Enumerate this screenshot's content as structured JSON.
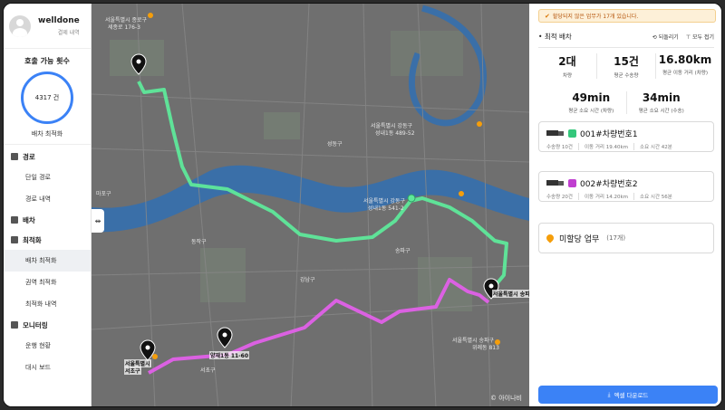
{
  "profile": {
    "name": "welldone",
    "sub_link": "결제 내역"
  },
  "quota": {
    "title": "호출 가능 횟수",
    "value": "4317 건",
    "button": "배차 최적화"
  },
  "menu": {
    "groups": [
      {
        "label": "경로",
        "items": [
          "단일 경로",
          "경로 내역"
        ]
      },
      {
        "label": "배차",
        "items": []
      },
      {
        "label": "최적화",
        "items": [
          "배차 최적화",
          "권역 최적화",
          "최적화 내역"
        ]
      },
      {
        "label": "모니터링",
        "items": [
          "운행 현황",
          "대시 보드"
        ]
      }
    ]
  },
  "map": {
    "labels": [
      "서울특별시 종로구",
      "세종로 176-3",
      "서울특별시 강동구",
      "성내1동 489-52",
      "서울특별시 강동구",
      "성내1동 541-2",
      "서울특별시 송파구",
      "위례동 813",
      "서울특별시",
      "서초구",
      "양재1동 11-60",
      "서울특별시 송파구",
      "송파구",
      "강남구",
      "서초구",
      "성동구",
      "동작구",
      "마포구"
    ],
    "watermark": "© 아이나비",
    "route_colors": {
      "vehicle1": "#5ee89a",
      "vehicle2": "#e060e8"
    }
  },
  "panel": {
    "alert": "할당되지 않은 업무가 17개 있습니다.",
    "section_title": "최적 배차",
    "actions": {
      "back": "되돌리기",
      "expand": "모두 접기"
    },
    "stats_row1": [
      {
        "value": "2대",
        "label": "차량"
      },
      {
        "value": "15건",
        "label": "평균 수송량"
      },
      {
        "value": "16.80km",
        "label": "평균 이동 거리 (차량)"
      }
    ],
    "stats_row2": [
      {
        "value": "49min",
        "label": "평균 소요 시간 (차량)"
      },
      {
        "value": "34min",
        "label": "평균 소요 시간 (수송)"
      }
    ],
    "vehicles": [
      {
        "name": "001#차량번호1",
        "color": "#34c77b",
        "meta": [
          "수송량 10건",
          "이동 거리 19.40km",
          "소요 시간 42분"
        ]
      },
      {
        "name": "002#차량번호2",
        "color": "#c03fd0",
        "meta": [
          "수송량 20건",
          "이동 거리 14.20km",
          "소요 시간 56분"
        ]
      }
    ],
    "unassigned": {
      "label": "미할당 업무",
      "count": "(17개)"
    },
    "download": "엑셀 다운로드"
  }
}
